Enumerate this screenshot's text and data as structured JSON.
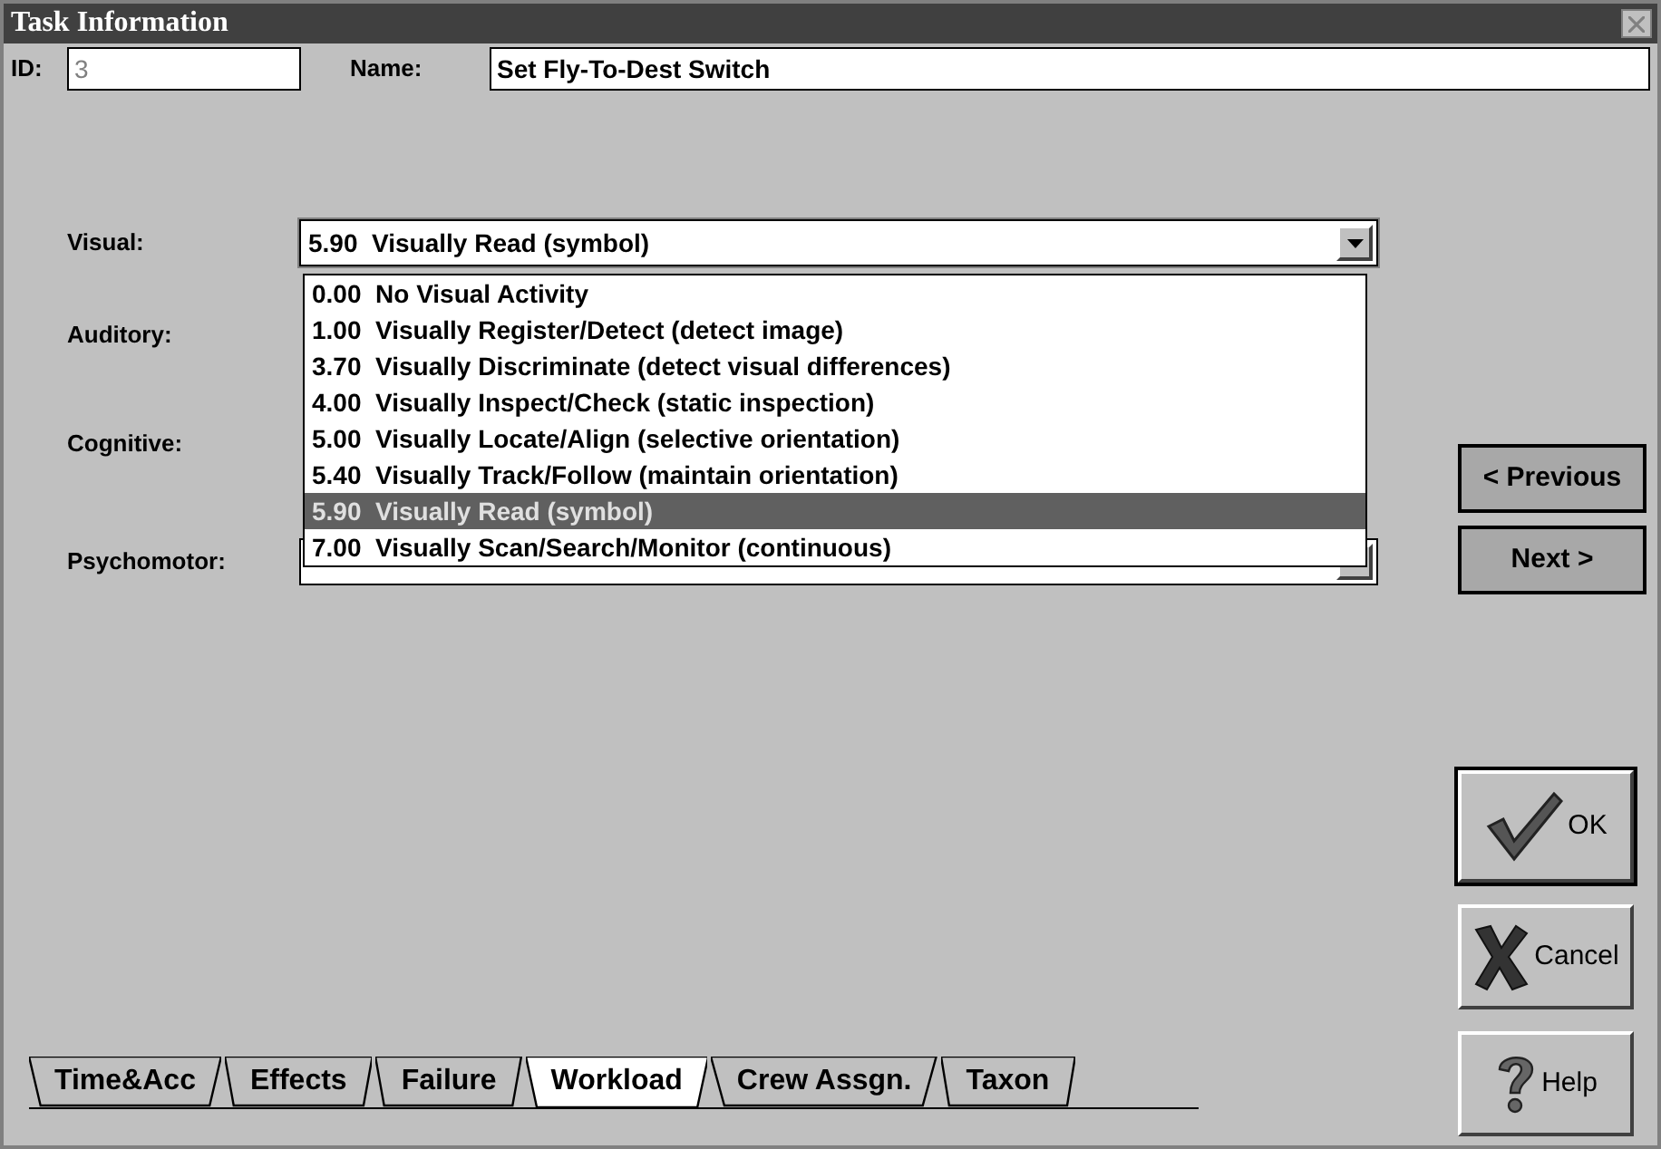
{
  "window": {
    "title": "Task Information"
  },
  "id_field": {
    "label": "ID:",
    "value": "3",
    "disabled": true
  },
  "name_field": {
    "label": "Name:",
    "value": "Set Fly-To-Dest Switch"
  },
  "fields": [
    {
      "label": "Visual:",
      "value": "5.90  Visually Read (symbol)",
      "expanded": true,
      "options": [
        {
          "text": "0.00  No Visual Activity",
          "selected": false
        },
        {
          "text": "1.00  Visually Register/Detect (detect image)",
          "selected": false
        },
        {
          "text": "3.70  Visually Discriminate (detect visual differences)",
          "selected": false
        },
        {
          "text": "4.00  Visually Inspect/Check (static inspection)",
          "selected": false
        },
        {
          "text": "5.00  Visually Locate/Align (selective orientation)",
          "selected": false
        },
        {
          "text": "5.40  Visually Track/Follow (maintain orientation)",
          "selected": false
        },
        {
          "text": "5.90  Visually Read (symbol)",
          "selected": true
        },
        {
          "text": "7.00  Visually Scan/Search/Monitor (continuous)",
          "selected": false
        }
      ]
    },
    {
      "label": "Auditory:"
    },
    {
      "label": "Cognitive:"
    },
    {
      "label": "Psychomotor:",
      "expanded": false
    }
  ],
  "nav_buttons": [
    "< Previous",
    "Next >"
  ],
  "action_buttons": [
    {
      "kind": "ok",
      "label": "OK",
      "default": true
    },
    {
      "kind": "cancel",
      "label": "Cancel",
      "default": false
    },
    {
      "kind": "help",
      "label": "Help",
      "default": false
    }
  ],
  "tabs": [
    {
      "label": "Time&Acc",
      "selected": false
    },
    {
      "label": "Effects",
      "selected": false
    },
    {
      "label": "Failure",
      "selected": false
    },
    {
      "label": "Workload",
      "selected": true
    },
    {
      "label": "Crew Assgn.",
      "selected": false
    },
    {
      "label": "Taxon",
      "selected": false
    }
  ]
}
